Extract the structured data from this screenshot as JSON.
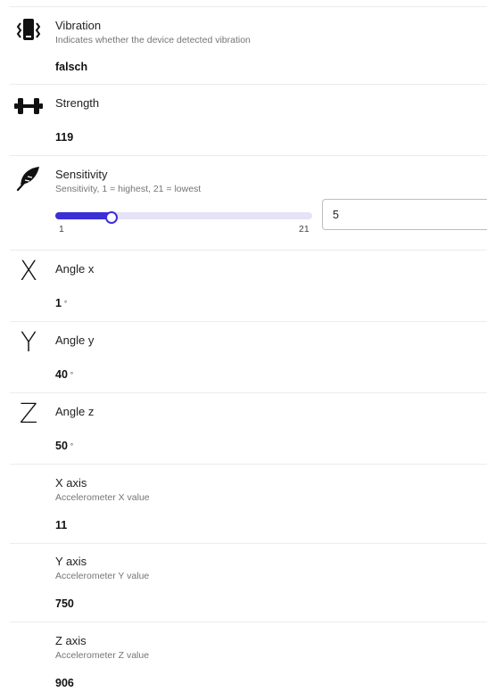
{
  "rows": {
    "vibration": {
      "title": "Vibration",
      "description": "Indicates whether the device detected vibration",
      "value": "falsch",
      "icon": "vibration-icon"
    },
    "strength": {
      "title": "Strength",
      "value": "119",
      "icon": "dumbbell-icon"
    },
    "sensitivity": {
      "title": "Sensitivity",
      "description": "Sensitivity, 1 = highest, 21 = lowest",
      "min_label": "1",
      "max_label": "21",
      "min": 1,
      "max": 21,
      "value": 5,
      "input_value": "5",
      "icon": "feather-icon"
    },
    "angle_x": {
      "title": "Angle x",
      "value": "1",
      "unit": "°",
      "icon_glyph": "X"
    },
    "angle_y": {
      "title": "Angle y",
      "value": "40",
      "unit": "°",
      "icon_glyph": "Y"
    },
    "angle_z": {
      "title": "Angle z",
      "value": "50",
      "unit": "°",
      "icon_glyph": "Z"
    },
    "x_axis": {
      "title": "X axis",
      "description": "Accelerometer X value",
      "value": "11"
    },
    "y_axis": {
      "title": "Y axis",
      "description": "Accelerometer Y value",
      "value": "750"
    },
    "z_axis": {
      "title": "Z axis",
      "description": "Accelerometer Z value",
      "value": "906"
    }
  },
  "colors": {
    "accent": "#3b2fd6",
    "track": "#e6e2f7",
    "divider": "#ececec"
  }
}
